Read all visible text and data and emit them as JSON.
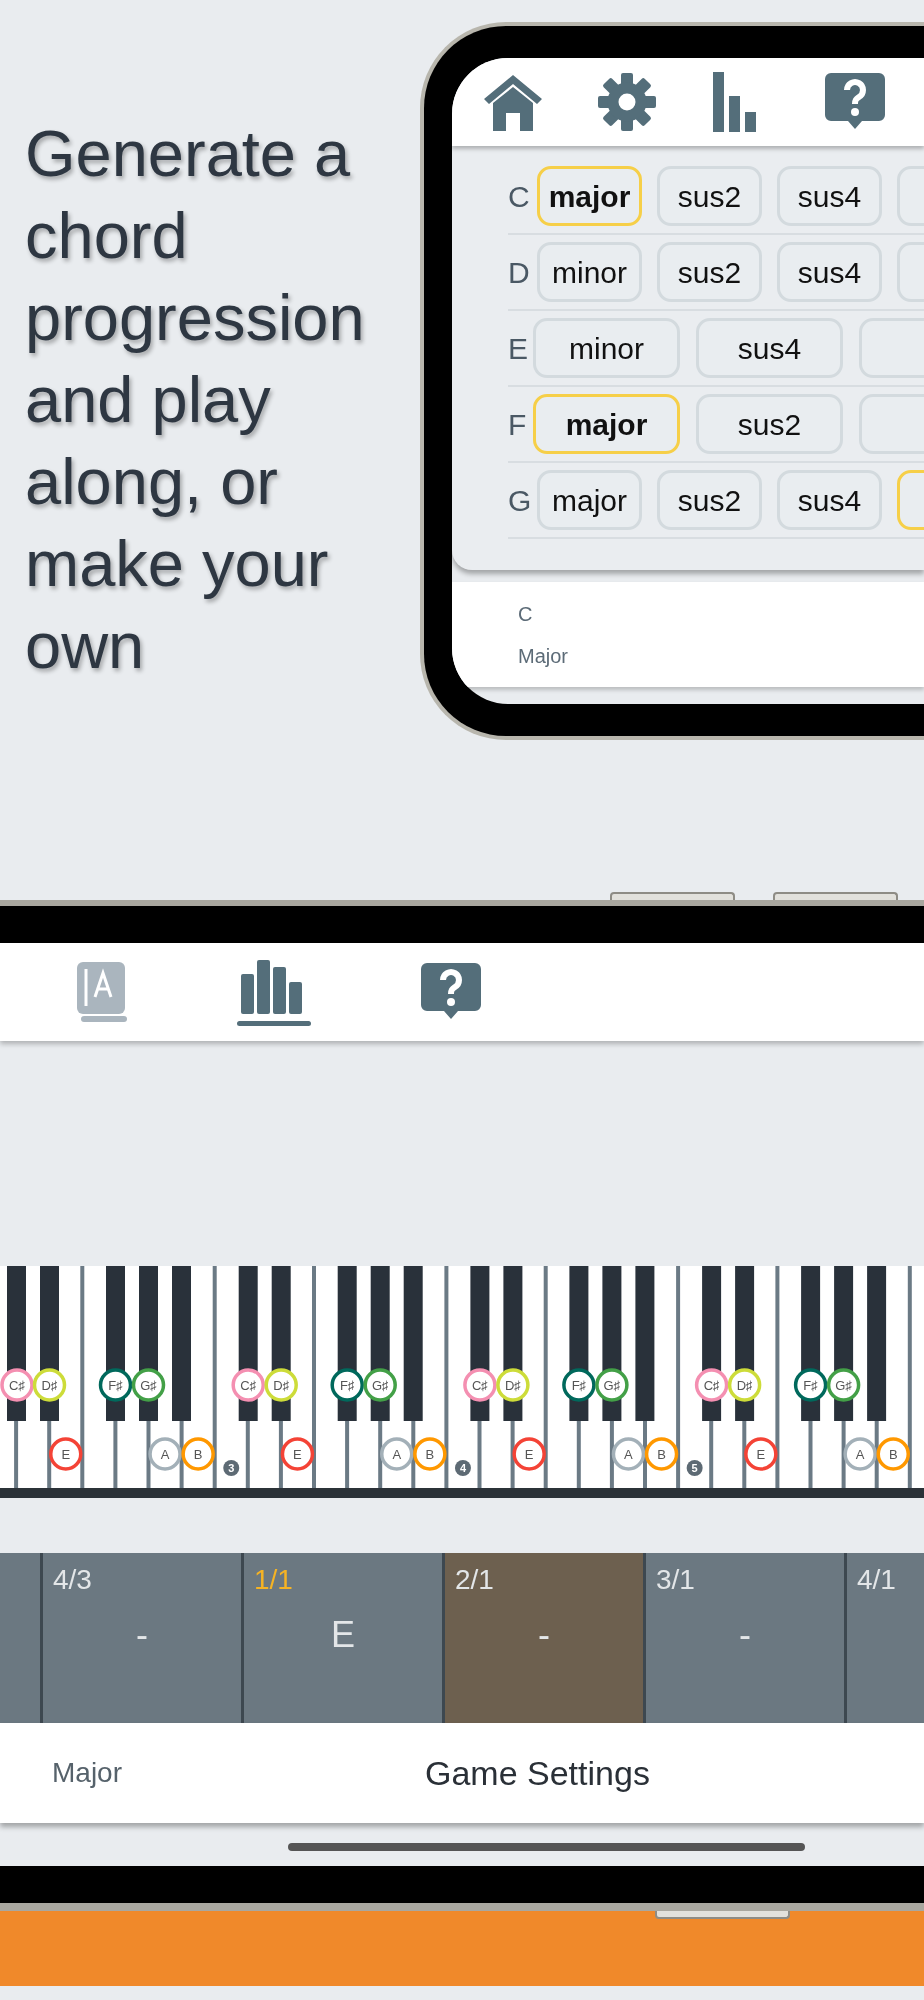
{
  "headline": "Generate a chord progression and play along, or make your own",
  "chord_screen": {
    "chord_rows": [
      {
        "root": "C",
        "kind": "narrow",
        "chords": [
          {
            "label": "major",
            "selected": true
          },
          {
            "label": "sus2",
            "selected": false
          },
          {
            "label": "sus4",
            "selected": false
          },
          {
            "selected": false
          }
        ]
      },
      {
        "root": "D",
        "kind": "narrow",
        "chords": [
          {
            "label": "minor",
            "selected": false
          },
          {
            "label": "sus2",
            "selected": false
          },
          {
            "label": "sus4",
            "selected": false
          },
          {
            "selected": false
          }
        ]
      },
      {
        "root": "E",
        "kind": "wide",
        "chords": [
          {
            "label": "minor",
            "selected": false
          },
          {
            "label": "sus4",
            "selected": false
          },
          {
            "selected": false
          }
        ]
      },
      {
        "root": "F",
        "kind": "wide",
        "chords": [
          {
            "label": "major",
            "selected": true
          },
          {
            "label": "sus2",
            "selected": false
          },
          {
            "selected": false
          }
        ]
      },
      {
        "root": "G",
        "kind": "narrow",
        "chords": [
          {
            "label": "major",
            "selected": false
          },
          {
            "label": "sus2",
            "selected": false
          },
          {
            "label": "sus4",
            "selected": false
          },
          {
            "selected": true
          }
        ]
      }
    ],
    "selection": {
      "root": "C",
      "quality": "Major"
    }
  },
  "game_screen": {
    "tabs": [
      {
        "kind": "book",
        "selected": false,
        "disabled": true
      },
      {
        "kind": "chart",
        "selected": true,
        "disabled": false
      },
      {
        "kind": "help",
        "selected": false,
        "disabled": false
      }
    ],
    "piano": {
      "octaves": [
        {
          "keys": [
            {
              "kind": "white"
            },
            {
              "kind": "black",
              "marker": {
                "label": "C♯",
                "color": "#f48fb1"
              }
            },
            {
              "kind": "white"
            },
            {
              "kind": "black",
              "marker": {
                "label": "D♯",
                "color": "#cddc39"
              }
            },
            {
              "kind": "white",
              "marker": {
                "label": "E",
                "color": "#f44336"
              }
            },
            {
              "kind": "white"
            },
            {
              "kind": "black",
              "marker": {
                "label": "F♯",
                "color": "#00695c"
              }
            },
            {
              "kind": "white"
            },
            {
              "kind": "black",
              "marker": {
                "label": "G♯",
                "color": "#43a047"
              }
            },
            {
              "kind": "white",
              "marker": {
                "label": "A",
                "color": "#a3b0b8"
              }
            },
            {
              "kind": "black"
            },
            {
              "kind": "white",
              "marker": {
                "label": "B",
                "color": "#ff9800"
              }
            }
          ]
        },
        {
          "number": "3",
          "keys": [
            {
              "kind": "white"
            },
            {
              "kind": "black",
              "marker": {
                "label": "C♯",
                "color": "#f48fb1"
              }
            },
            {
              "kind": "white"
            },
            {
              "kind": "black",
              "marker": {
                "label": "D♯",
                "color": "#cddc39"
              }
            },
            {
              "kind": "white",
              "marker": {
                "label": "E",
                "color": "#f44336"
              }
            },
            {
              "kind": "white"
            },
            {
              "kind": "black",
              "marker": {
                "label": "F♯",
                "color": "#00695c"
              }
            },
            {
              "kind": "white"
            },
            {
              "kind": "black",
              "marker": {
                "label": "G♯",
                "color": "#43a047"
              }
            },
            {
              "kind": "white",
              "marker": {
                "label": "A",
                "color": "#a3b0b8"
              }
            },
            {
              "kind": "black"
            },
            {
              "kind": "white",
              "marker": {
                "label": "B",
                "color": "#ff9800"
              }
            }
          ]
        },
        {
          "number": "4",
          "keys": [
            {
              "kind": "white"
            },
            {
              "kind": "black",
              "marker": {
                "label": "C♯",
                "color": "#f48fb1"
              }
            },
            {
              "kind": "white"
            },
            {
              "kind": "black",
              "marker": {
                "label": "D♯",
                "color": "#cddc39"
              }
            },
            {
              "kind": "white",
              "marker": {
                "label": "E",
                "color": "#f44336"
              }
            },
            {
              "kind": "white"
            },
            {
              "kind": "black",
              "marker": {
                "label": "F♯",
                "color": "#00695c"
              }
            },
            {
              "kind": "white"
            },
            {
              "kind": "black",
              "marker": {
                "label": "G♯",
                "color": "#43a047"
              }
            },
            {
              "kind": "white",
              "marker": {
                "label": "A",
                "color": "#a3b0b8"
              }
            },
            {
              "kind": "black"
            },
            {
              "kind": "white",
              "marker": {
                "label": "B",
                "color": "#ff9800"
              }
            }
          ]
        },
        {
          "number": "5",
          "keys": [
            {
              "kind": "white"
            },
            {
              "kind": "black",
              "marker": {
                "label": "C♯",
                "color": "#f48fb1"
              }
            },
            {
              "kind": "white"
            },
            {
              "kind": "black",
              "marker": {
                "label": "D♯",
                "color": "#cddc39"
              }
            },
            {
              "kind": "white",
              "marker": {
                "label": "E",
                "color": "#f44336"
              }
            },
            {
              "kind": "white"
            },
            {
              "kind": "black",
              "marker": {
                "label": "F♯",
                "color": "#00695c"
              }
            },
            {
              "kind": "white"
            },
            {
              "kind": "black",
              "marker": {
                "label": "G♯",
                "color": "#43a047"
              }
            },
            {
              "kind": "white",
              "marker": {
                "label": "A",
                "color": "#a3b0b8"
              }
            },
            {
              "kind": "black"
            },
            {
              "kind": "white",
              "marker": {
                "label": "B",
                "color": "#ff9800"
              }
            }
          ]
        },
        {
          "keys": [
            {
              "kind": "white"
            }
          ]
        }
      ]
    },
    "bars": [
      {
        "label": "4/3",
        "chord": "-",
        "selected": false,
        "current": false
      },
      {
        "label": "1/1",
        "chord": "E",
        "selected": false,
        "current": true
      },
      {
        "label": "2/1",
        "chord": "-",
        "selected": true,
        "current": false
      },
      {
        "label": "3/1",
        "chord": "-",
        "selected": false,
        "current": false
      },
      {
        "label": "4/1",
        "selected": false,
        "current": false
      }
    ],
    "footer": {
      "scale": "Major",
      "title": "Game Settings"
    }
  }
}
